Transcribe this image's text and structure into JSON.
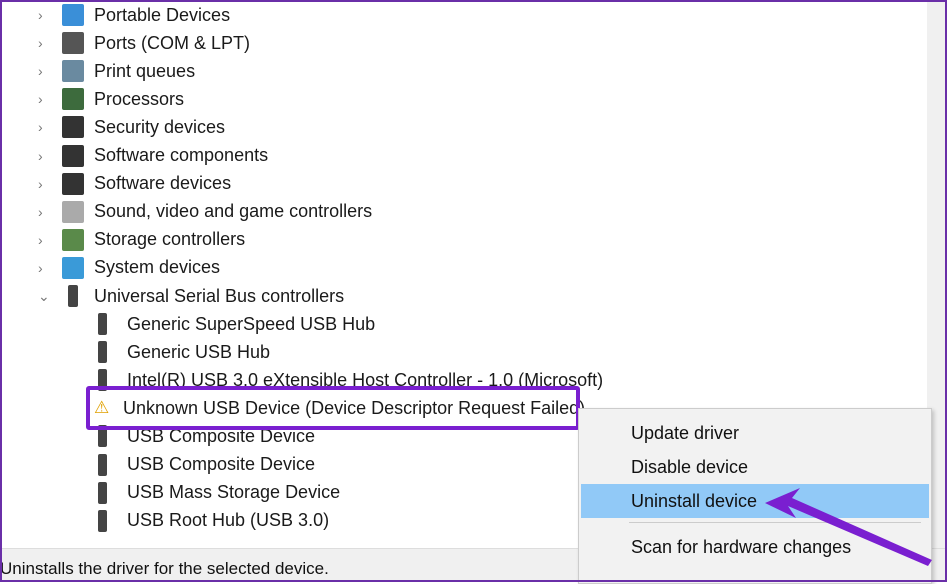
{
  "categories": [
    {
      "label": "Portable Devices",
      "icon": "portable-device-icon"
    },
    {
      "label": "Ports (COM & LPT)",
      "icon": "port-icon"
    },
    {
      "label": "Print queues",
      "icon": "printer-icon"
    },
    {
      "label": "Processors",
      "icon": "processor-icon"
    },
    {
      "label": "Security devices",
      "icon": "security-device-icon"
    },
    {
      "label": "Software components",
      "icon": "software-component-icon"
    },
    {
      "label": "Software devices",
      "icon": "software-device-icon"
    },
    {
      "label": "Sound, video and game controllers",
      "icon": "speaker-icon"
    },
    {
      "label": "Storage controllers",
      "icon": "storage-icon"
    },
    {
      "label": "System devices",
      "icon": "system-device-icon"
    },
    {
      "label": "Universal Serial Bus controllers",
      "icon": "usb-icon",
      "expanded": true
    }
  ],
  "usb_children": [
    {
      "label": "Generic SuperSpeed USB Hub"
    },
    {
      "label": "Generic USB Hub"
    },
    {
      "label": "Intel(R) USB 3.0 eXtensible Host Controller - 1.0 (Microsoft)"
    },
    {
      "label": "Unknown USB Device (Device Descriptor Request Failed)",
      "warning": true,
      "selected": true
    },
    {
      "label": "USB Composite Device"
    },
    {
      "label": "USB Composite Device"
    },
    {
      "label": "USB Mass Storage Device"
    },
    {
      "label": "USB Root Hub (USB 3.0)"
    }
  ],
  "context_menu": {
    "items": [
      "Update driver",
      "Disable device",
      "Uninstall device",
      "Scan for hardware changes"
    ],
    "highlighted": "Uninstall device"
  },
  "status_bar": "Uninstalls the driver for the selected device.",
  "colors": {
    "annotation": "#7a1fd0",
    "menu_highlight": "#91c9f7"
  }
}
